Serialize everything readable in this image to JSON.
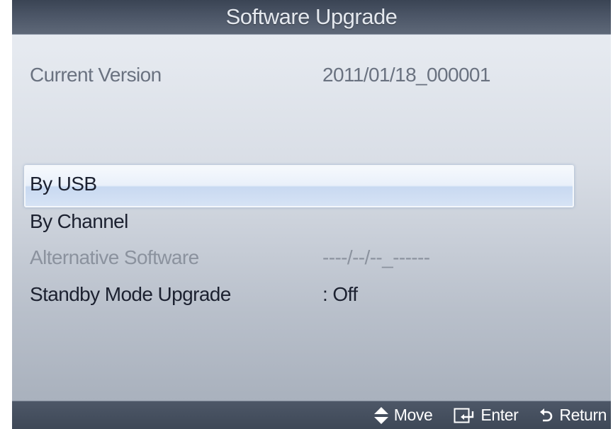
{
  "title": "Software Upgrade",
  "current_version": {
    "label": "Current Version",
    "value": "2011/01/18_000001"
  },
  "menu": {
    "by_usb": "By USB",
    "by_channel": "By Channel",
    "alternative_software": {
      "label": "Alternative Software",
      "value": "----/--/--_------"
    },
    "standby_mode_upgrade": {
      "label": "Standby Mode Upgrade",
      "value": ": Off"
    }
  },
  "selected_item": "By USB",
  "footer": {
    "move": {
      "icon": "up-down-arrow-icon",
      "label": "Move"
    },
    "enter": {
      "icon": "enter-icon",
      "label": "Enter"
    },
    "return": {
      "icon": "return-icon",
      "label": "Return"
    }
  }
}
